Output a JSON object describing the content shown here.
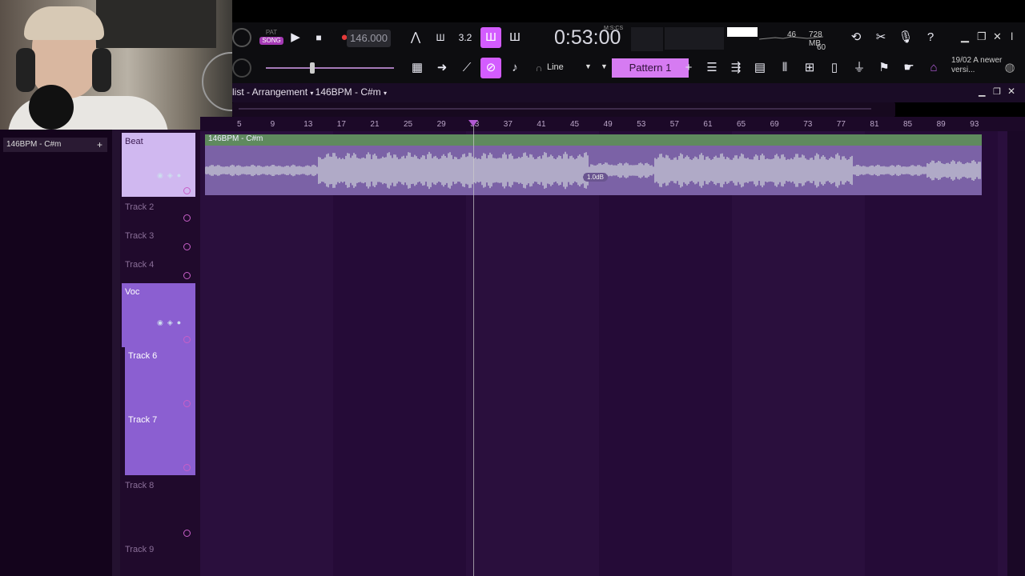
{
  "toolbar": {
    "pat_label": "PAT",
    "song_label": "SONG",
    "tempo": "146.000",
    "time": "0:53:00",
    "time_unit": "M:S:CS",
    "cpu": "46",
    "memory": "728 MB",
    "polyphony": "60",
    "snap": "Line",
    "pattern": "Pattern 1",
    "news": "19/02  A newer versi..."
  },
  "playlist": {
    "title": "list - Arrangement",
    "project": "146BPM - C#m",
    "left_item": "146BPM - C#m",
    "ruler_ticks": [
      "5",
      "9",
      "13",
      "17",
      "21",
      "25",
      "29",
      "33",
      "37",
      "41",
      "45",
      "49",
      "53",
      "57",
      "61",
      "65",
      "69",
      "73",
      "77",
      "81",
      "85",
      "89",
      "93"
    ],
    "clip_name": "146BPM - C#m",
    "clip_gain": "1.0dB"
  },
  "tracks": [
    {
      "name": "Beat"
    },
    {
      "name": "Track 2"
    },
    {
      "name": "Track 3"
    },
    {
      "name": "Track 4"
    },
    {
      "name": "Voc"
    },
    {
      "name": "Track 6"
    },
    {
      "name": "Track 7"
    },
    {
      "name": "Track 8"
    },
    {
      "name": "Track 9"
    }
  ],
  "colors": {
    "accent": "#d35cff",
    "grid": "#2a0f3d",
    "clip": "#7b62a6",
    "clip_header": "#5f8a5e"
  }
}
